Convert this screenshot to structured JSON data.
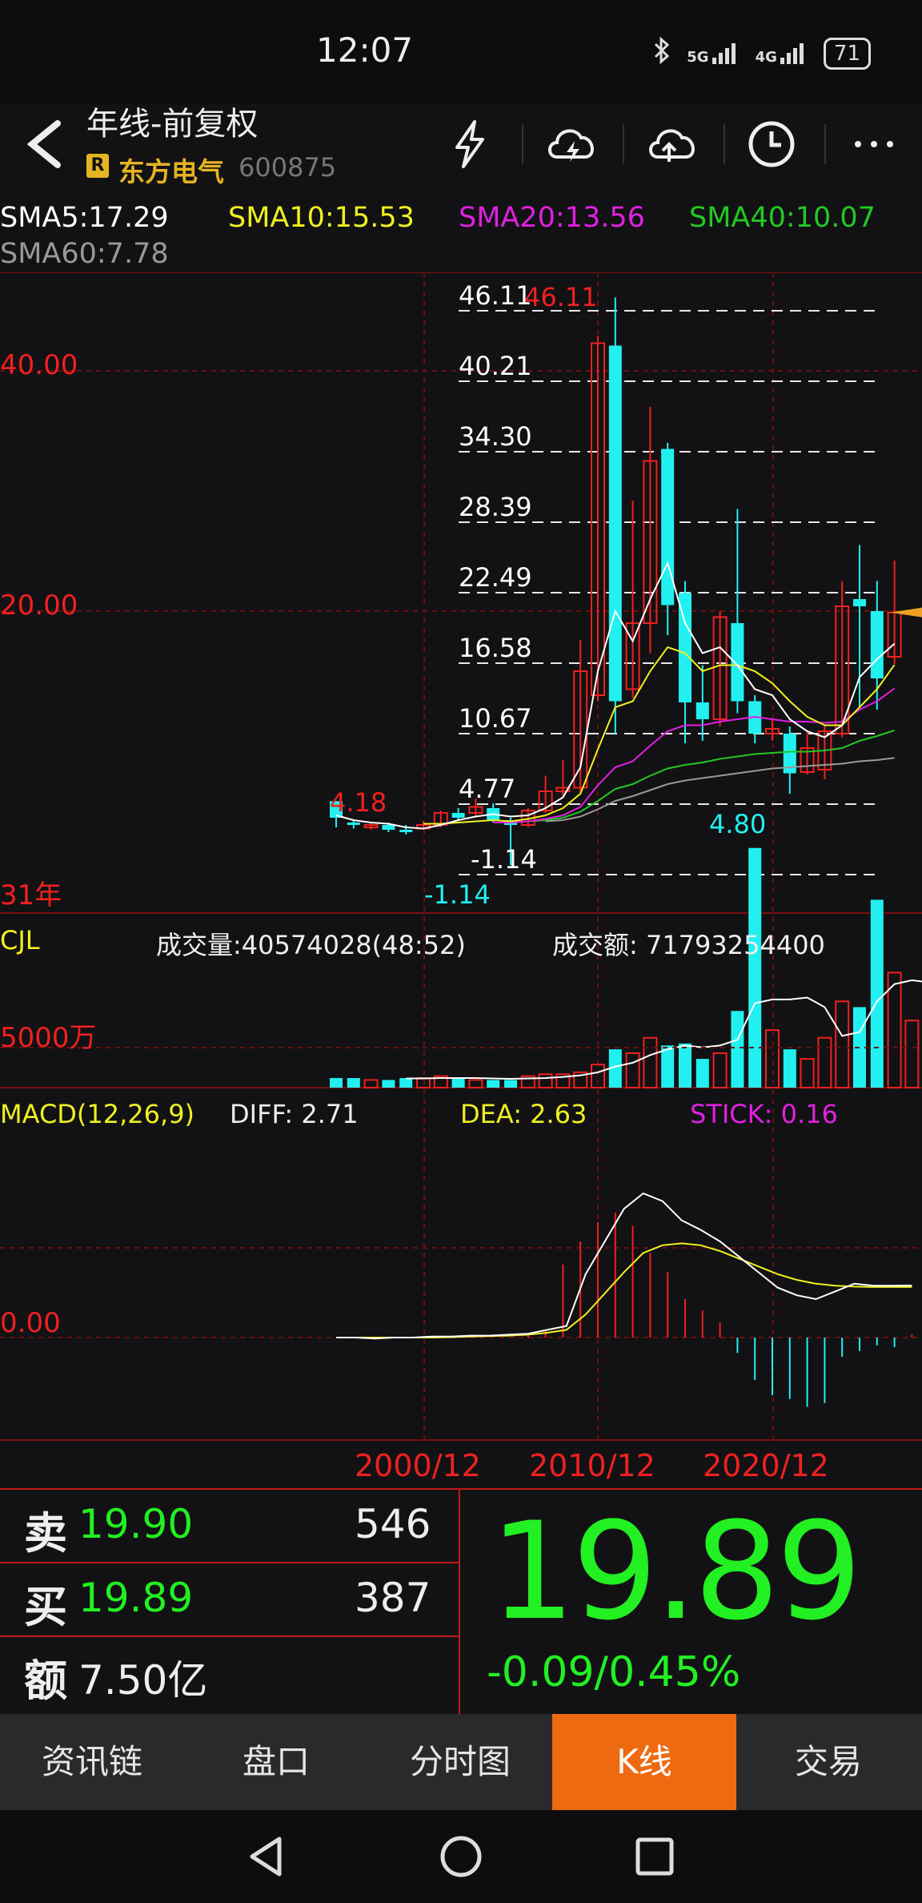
{
  "status": {
    "time": "12:07",
    "net1": "5G",
    "net2": "4G",
    "battery": "71"
  },
  "header": {
    "title": "年线-前复权",
    "badge": "R",
    "stock_name": "东方电气",
    "stock_code": "600875"
  },
  "sma": {
    "sma5": "SMA5:17.29",
    "sma10": "SMA10:15.53",
    "sma20": "SMA20:13.56",
    "sma40": "SMA40:10.07",
    "sma60": "SMA60:7.78"
  },
  "colors": {
    "up": "#f02020",
    "down": "#22f0f0",
    "sma5": "#ffffff",
    "sma10": "#f0f020",
    "sma20": "#e020e0",
    "sma40": "#22c822",
    "sma60": "#999999",
    "price": "#22f022",
    "tab_active": "#ee6a10"
  },
  "main_chart": {
    "y_labels": [
      "40.00",
      "20.00"
    ],
    "levels": [
      "46.11",
      "40.21",
      "34.30",
      "28.39",
      "22.49",
      "16.58",
      "10.67",
      "4.77",
      "-1.14"
    ],
    "max_label": "46.11",
    "min_label": "-1.14",
    "local_high": "4.18",
    "local_low": "4.80",
    "period_label": "31年"
  },
  "volume": {
    "label": "CJL",
    "vol_text": "成交量:40574028(48:52)",
    "amt_text": "成交额: 71793254400",
    "y_label": "5000万"
  },
  "macd": {
    "label": "MACD(12,26,9)",
    "diff": "DIFF: 2.71",
    "dea": "DEA: 2.63",
    "stick": "STICK: 0.16",
    "zero": "0.00"
  },
  "x_axis": [
    "2000/12",
    "2010/12",
    "2020/12"
  ],
  "quote": {
    "sell_label": "卖",
    "sell_price": "19.90",
    "sell_vol": "546",
    "buy_label": "买",
    "buy_price": "19.89",
    "buy_vol": "387",
    "amount_label": "额",
    "amount": "7.50亿",
    "last": "19.89",
    "change": "-0.09/0.45%"
  },
  "tabs": [
    "资讯链",
    "盘口",
    "分时图",
    "K线",
    "交易"
  ],
  "chart_data": {
    "type": "candlestick",
    "candles": [
      {
        "o": 2.8,
        "c": 4.18,
        "h": 4.18,
        "l": 2.0,
        "d": "down"
      },
      {
        "o": 2.4,
        "c": 2.2,
        "h": 2.6,
        "l": 1.9,
        "d": "down"
      },
      {
        "o": 2.0,
        "c": 2.2,
        "h": 2.4,
        "l": 1.8,
        "d": "up"
      },
      {
        "o": 2.2,
        "c": 1.8,
        "h": 2.4,
        "l": 1.6,
        "d": "down"
      },
      {
        "o": 1.8,
        "c": 1.6,
        "h": 2.2,
        "l": 1.4,
        "d": "down"
      },
      {
        "o": 1.9,
        "c": 2.2,
        "h": 2.5,
        "l": 1.8,
        "d": "up"
      },
      {
        "o": 2.2,
        "c": 3.2,
        "h": 3.4,
        "l": 2.0,
        "d": "up"
      },
      {
        "o": 3.2,
        "c": 2.8,
        "h": 3.6,
        "l": 2.6,
        "d": "down"
      },
      {
        "o": 3.2,
        "c": 3.7,
        "h": 4.4,
        "l": 2.9,
        "d": "up"
      },
      {
        "o": 3.6,
        "c": 2.6,
        "h": 4.0,
        "l": 2.4,
        "d": "down"
      },
      {
        "o": 2.6,
        "c": 2.2,
        "h": 2.8,
        "l": -1.14,
        "d": "down"
      },
      {
        "o": 2.2,
        "c": 3.4,
        "h": 3.6,
        "l": 2.0,
        "d": "up"
      },
      {
        "o": 3.4,
        "c": 5.0,
        "h": 6.3,
        "l": 3.2,
        "d": "up"
      },
      {
        "o": 5.0,
        "c": 5.3,
        "h": 7.6,
        "l": 4.6,
        "d": "up"
      },
      {
        "o": 5.3,
        "c": 15.0,
        "h": 17.6,
        "l": 4.8,
        "d": "up"
      },
      {
        "o": 13.0,
        "c": 42.3,
        "h": 42.9,
        "l": 12.5,
        "d": "up"
      },
      {
        "o": 42.1,
        "c": 12.5,
        "h": 46.11,
        "l": 9.8,
        "d": "down"
      },
      {
        "o": 13.5,
        "c": 19.0,
        "h": 29.2,
        "l": 12.8,
        "d": "up"
      },
      {
        "o": 19.0,
        "c": 32.5,
        "h": 37.0,
        "l": 16.5,
        "d": "up"
      },
      {
        "o": 33.5,
        "c": 20.5,
        "h": 34.0,
        "l": 18.0,
        "d": "down"
      },
      {
        "o": 21.5,
        "c": 12.4,
        "h": 22.5,
        "l": 9.0,
        "d": "down"
      },
      {
        "o": 12.4,
        "c": 11.0,
        "h": 15.5,
        "l": 9.2,
        "d": "down"
      },
      {
        "o": 11.0,
        "c": 19.5,
        "h": 20.0,
        "l": 10.4,
        "d": "up"
      },
      {
        "o": 19.0,
        "c": 12.5,
        "h": 28.5,
        "l": 11.5,
        "d": "down"
      },
      {
        "o": 12.5,
        "c": 9.8,
        "h": 13.0,
        "l": 9.0,
        "d": "down"
      },
      {
        "o": 9.8,
        "c": 10.2,
        "h": 11.0,
        "l": 9.2,
        "d": "up"
      },
      {
        "o": 9.8,
        "c": 6.5,
        "h": 10.4,
        "l": 4.8,
        "d": "down"
      },
      {
        "o": 6.6,
        "c": 8.6,
        "h": 10.0,
        "l": 6.4,
        "d": "up"
      },
      {
        "o": 6.8,
        "c": 10.0,
        "h": 10.5,
        "l": 6.0,
        "d": "up"
      },
      {
        "o": 9.8,
        "c": 20.4,
        "h": 22.5,
        "l": 9.5,
        "d": "up"
      },
      {
        "o": 21.0,
        "c": 20.4,
        "h": 25.5,
        "l": 12.0,
        "d": "down"
      },
      {
        "o": 20.0,
        "c": 14.4,
        "h": 22.5,
        "l": 11.8,
        "d": "down"
      },
      {
        "o": 16.2,
        "c": 19.89,
        "h": 24.2,
        "l": 15.6,
        "d": "up"
      }
    ],
    "sma5": [
      3.0,
      2.6,
      2.4,
      2.3,
      2.0,
      1.9,
      2.2,
      2.6,
      2.9,
      3.1,
      2.9,
      3.0,
      3.6,
      4.5,
      7.0,
      15.0,
      20.0,
      17.5,
      21.0,
      24.0,
      19.0,
      16.5,
      17.0,
      15.5,
      13.5,
      13.0,
      11.0,
      10.0,
      9.5,
      10.5,
      14.5,
      16.0,
      17.29
    ],
    "sma10": [
      null,
      null,
      null,
      null,
      null,
      2.3,
      2.3,
      2.4,
      2.5,
      2.6,
      2.5,
      2.7,
      3.0,
      3.6,
      4.8,
      8.5,
      12.0,
      12.5,
      15.0,
      17.0,
      16.5,
      15.0,
      15.5,
      15.5,
      15.0,
      14.0,
      12.5,
      11.2,
      10.5,
      10.5,
      12.0,
      13.5,
      15.53
    ],
    "sma20": [
      null,
      null,
      null,
      null,
      null,
      null,
      null,
      null,
      null,
      2.4,
      2.4,
      2.5,
      2.7,
      3.0,
      3.7,
      5.5,
      7.0,
      7.5,
      8.8,
      10.0,
      10.5,
      10.5,
      10.8,
      11.0,
      11.2,
      11.0,
      10.8,
      10.8,
      10.7,
      10.8,
      11.8,
      12.5,
      13.56
    ],
    "sma40": [
      null,
      null,
      null,
      null,
      null,
      null,
      null,
      null,
      null,
      null,
      null,
      2.5,
      2.6,
      2.8,
      3.3,
      4.2,
      5.2,
      5.6,
      6.3,
      6.9,
      7.2,
      7.4,
      7.7,
      7.9,
      8.1,
      8.2,
      8.3,
      8.3,
      8.4,
      8.6,
      9.2,
      9.6,
      10.07
    ],
    "sma60": [
      null,
      null,
      null,
      null,
      null,
      null,
      null,
      null,
      null,
      null,
      null,
      null,
      2.5,
      2.6,
      2.9,
      3.5,
      4.2,
      4.6,
      5.1,
      5.6,
      5.9,
      6.1,
      6.3,
      6.5,
      6.7,
      6.9,
      7.0,
      7.1,
      7.2,
      7.3,
      7.5,
      7.6,
      7.78
    ],
    "volume": [
      0.5,
      0.5,
      0.4,
      0.4,
      0.5,
      0.5,
      0.6,
      0.5,
      0.4,
      0.4,
      0.4,
      0.6,
      0.7,
      0.7,
      0.8,
      1.2,
      2.0,
      1.8,
      2.6,
      2.2,
      2.3,
      1.5,
      1.8,
      4.0,
      12.5,
      3.0,
      2.0,
      1.5,
      2.6,
      4.5,
      4.2,
      9.8,
      6.0,
      3.5,
      4.2
    ],
    "volume_ma": [
      null,
      null,
      null,
      null,
      0.48,
      0.48,
      0.5,
      0.5,
      0.5,
      0.48,
      0.46,
      0.48,
      0.5,
      0.56,
      0.64,
      0.8,
      1.1,
      1.3,
      1.7,
      2.0,
      2.2,
      2.1,
      2.2,
      2.5,
      4.4,
      4.6,
      4.6,
      4.7,
      4.2,
      2.7,
      2.9,
      4.5,
      5.4,
      5.6,
      5.5
    ],
    "macd_diff": [
      0,
      0,
      -0.05,
      0,
      0,
      0.05,
      0.05,
      0.1,
      0.1,
      0.15,
      0.2,
      0.4,
      0.6,
      3.3,
      5.0,
      6.7,
      7.5,
      7.1,
      6.1,
      5.6,
      5.0,
      4.2,
      3.4,
      2.6,
      2.2,
      2.0,
      2.4,
      2.8,
      2.7,
      2.7,
      2.71
    ],
    "macd_dea": [
      0,
      0,
      0,
      0,
      0,
      0,
      0.02,
      0.05,
      0.08,
      0.1,
      0.15,
      0.25,
      0.4,
      1.2,
      2.3,
      3.4,
      4.4,
      4.8,
      4.9,
      4.8,
      4.5,
      4.1,
      3.7,
      3.3,
      3.0,
      2.8,
      2.7,
      2.65,
      2.63,
      2.63,
      2.63
    ],
    "macd_stick": [
      0,
      0,
      0,
      0,
      0,
      0,
      0,
      0,
      0,
      0,
      0,
      0.2,
      0.4,
      3.8,
      5.0,
      6.0,
      6.5,
      5.8,
      4.4,
      3.4,
      2.0,
      1.4,
      0.8,
      -0.8,
      -2.2,
      -3.0,
      -3.2,
      -3.6,
      -3.4,
      -1.0,
      -0.7,
      -0.4,
      -0.5,
      0.16
    ]
  }
}
